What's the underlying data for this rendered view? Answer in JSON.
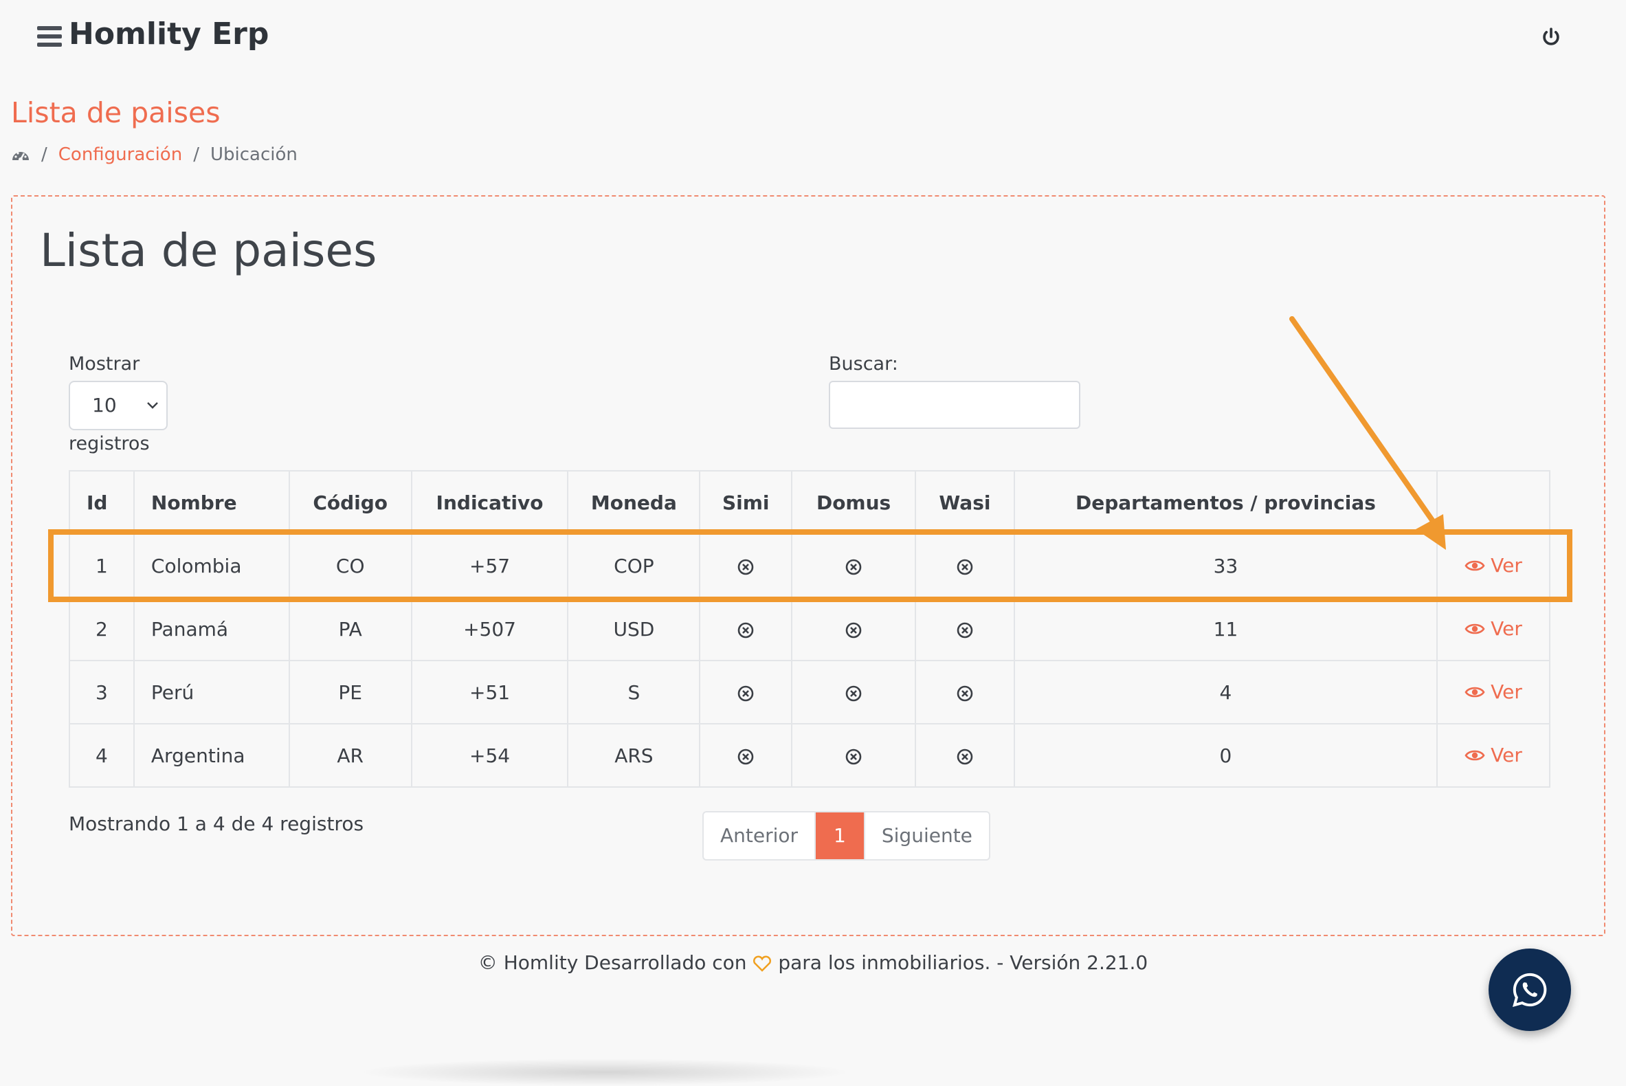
{
  "app": {
    "title": "Homlity Erp"
  },
  "page": {
    "title": "Lista de paises"
  },
  "breadcrumb": {
    "items": [
      "Configuración",
      "Ubicación"
    ]
  },
  "card": {
    "title": "Lista de paises"
  },
  "length": {
    "label_before": "Mostrar",
    "value": "10",
    "label_after": "registros"
  },
  "search": {
    "label": "Buscar:",
    "value": ""
  },
  "table": {
    "headers": [
      "Id",
      "Nombre",
      "Código",
      "Indicativo",
      "Moneda",
      "Simi",
      "Domus",
      "Wasi",
      "Departamentos / provincias",
      ""
    ],
    "rows": [
      {
        "id": "1",
        "nombre": "Colombia",
        "codigo": "CO",
        "indicativo": "+57",
        "moneda": "COP",
        "departamentos": "33",
        "action": "Ver"
      },
      {
        "id": "2",
        "nombre": "Panamá",
        "codigo": "PA",
        "indicativo": "+507",
        "moneda": "USD",
        "departamentos": "11",
        "action": "Ver"
      },
      {
        "id": "3",
        "nombre": "Perú",
        "codigo": "PE",
        "indicativo": "+51",
        "moneda": "S",
        "departamentos": "4",
        "action": "Ver"
      },
      {
        "id": "4",
        "nombre": "Argentina",
        "codigo": "AR",
        "indicativo": "+54",
        "moneda": "ARS",
        "departamentos": "0",
        "action": "Ver"
      }
    ]
  },
  "info": "Mostrando 1 a 4 de 4 registros",
  "pagination": {
    "prev": "Anterior",
    "current": "1",
    "next": "Siguiente"
  },
  "footer": {
    "before": "© Homlity Desarrollado con",
    "after": "para los inmobiliarios. - Versión 2.21.0"
  },
  "colors": {
    "accent": "#ef6c4f",
    "highlight": "#f0992f",
    "whatsapp_bg": "#0f2c52"
  },
  "icons": [
    "menu-icon",
    "power-icon",
    "dashboard-icon",
    "chevron-down-icon",
    "circle-x-icon",
    "eye-icon",
    "heart-icon",
    "whatsapp-icon"
  ]
}
